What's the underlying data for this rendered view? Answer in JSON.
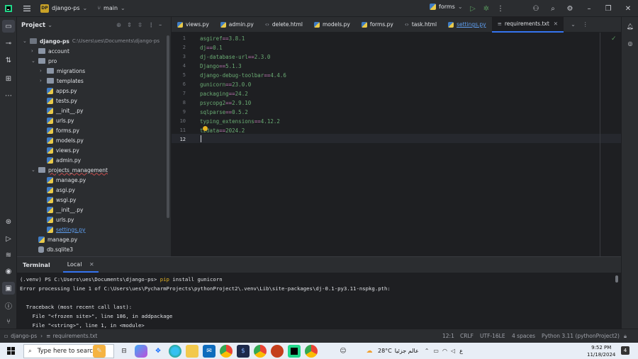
{
  "titlebar": {
    "project_badge": "DP",
    "project_name": "django-ps",
    "branch": "main",
    "run_config": "forms"
  },
  "project_panel": {
    "title": "Project",
    "root_name": "django-ps",
    "root_path": "C:\\Users\\ues\\Documents\\django-ps",
    "tree": [
      {
        "label": "account",
        "type": "folder"
      },
      {
        "label": "pro",
        "type": "folder"
      },
      {
        "label": "migrations",
        "type": "folder"
      },
      {
        "label": "templates",
        "type": "folder"
      },
      {
        "label": "apps.py",
        "type": "py"
      },
      {
        "label": "tests.py",
        "type": "py"
      },
      {
        "label": "__init__.py",
        "type": "py"
      },
      {
        "label": "urls.py",
        "type": "py"
      },
      {
        "label": "forms.py",
        "type": "py"
      },
      {
        "label": "models.py",
        "type": "py"
      },
      {
        "label": "views.py",
        "type": "py"
      },
      {
        "label": "admin.py",
        "type": "py"
      },
      {
        "label": "projects_management",
        "type": "folder"
      },
      {
        "label": "manage.py",
        "type": "py"
      },
      {
        "label": "asgi.py",
        "type": "py"
      },
      {
        "label": "wsgi.py",
        "type": "py"
      },
      {
        "label": "__init__.py",
        "type": "py"
      },
      {
        "label": "urls.py",
        "type": "py"
      },
      {
        "label": "settings.py",
        "type": "py"
      },
      {
        "label": "manage.py",
        "type": "py"
      },
      {
        "label": "db.sqlite3",
        "type": "db"
      }
    ]
  },
  "tabs": [
    {
      "label": "views.py"
    },
    {
      "label": "admin.py"
    },
    {
      "label": "delete.html"
    },
    {
      "label": "models.py"
    },
    {
      "label": "forms.py"
    },
    {
      "label": "task.html"
    },
    {
      "label": "settings.py"
    },
    {
      "label": "requirements.txt"
    }
  ],
  "editor": {
    "lines": [
      "asgiref==3.8.1",
      "dj==0.1",
      "dj-database-url==2.3.0",
      "Django==5.1.3",
      "django-debug-toolbar==4.4.6",
      "gunicorn==23.0.0",
      "packaging==24.2",
      "psycopg2==2.9.10",
      "sqlparse==0.5.2",
      "typing_extensions==4.12.2",
      "tzdata==2024.2",
      ""
    ],
    "line_numbers": [
      "1",
      "2",
      "3",
      "4",
      "5",
      "6",
      "7",
      "8",
      "9",
      "10",
      "11",
      "12"
    ]
  },
  "terminal": {
    "tab_title": "Terminal",
    "tab_local": "Local",
    "prompt": "(.venv) PS C:\\Users\\ues\\Documents\\django-ps>",
    "command": "pip",
    "command_args": "install gunicorn",
    "output": [
      "Error processing line 1 of C:\\Users\\ues\\PycharmProjects\\pythonProject2\\.venv\\Lib\\site-packages\\dj-0.1-py3.11-nspkg.pth:",
      "",
      "  Traceback (most recent call last):",
      "    File \"<frozen site>\", line 186, in addpackage",
      "    File \"<string>\", line 1, in <module>"
    ]
  },
  "statusbar": {
    "crumb_project": "django-ps",
    "crumb_file": "requirements.txt",
    "position": "12:1",
    "line_sep": "CRLF",
    "encoding": "UTF-16LE",
    "indent": "4 spaces",
    "interpreter": "Python 3.11 (pythonProject2)"
  },
  "taskbar": {
    "search_placeholder": "Type here to search",
    "weather": "28°C",
    "weather_text": "عالم جزئيا",
    "lang": "ع",
    "time": "9:52 PM",
    "date": "11/18/2024",
    "notif_count": "4"
  },
  "colors": {
    "accent": "#3574f0",
    "code_value": "#6aab73",
    "panel_bg": "#2b2d30",
    "editor_bg": "#1e1f22"
  }
}
